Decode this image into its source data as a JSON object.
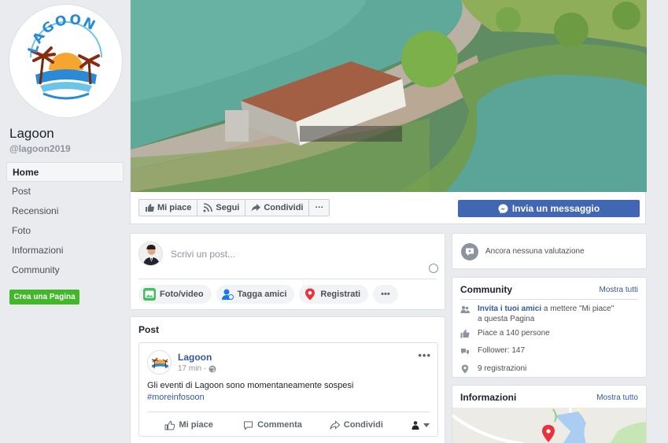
{
  "page": {
    "name": "Lagoon",
    "handle": "@lagoon2019",
    "logo_text": "LAGOON"
  },
  "nav": {
    "items": [
      {
        "label": "Home",
        "active": true
      },
      {
        "label": "Post"
      },
      {
        "label": "Recensioni"
      },
      {
        "label": "Foto"
      },
      {
        "label": "Informazioni"
      },
      {
        "label": "Community"
      }
    ],
    "create_page": "Crea una Pagina"
  },
  "cover_actions": {
    "like": "Mi piace",
    "follow": "Segui",
    "share": "Condividi",
    "more": "···",
    "message": "Invia un messaggio"
  },
  "composer": {
    "placeholder": "Scrivi un post...",
    "photo": "Foto/video",
    "tag": "Tagga amici",
    "checkin": "Registrati",
    "more": "•••"
  },
  "posts": {
    "title": "Post",
    "item": {
      "author": "Lagoon",
      "time": "17 min ·",
      "text": "Gli eventi di Lagoon sono momentaneamente sospesi",
      "hashtag": "#moreinfosoon",
      "like": "Mi piace",
      "comment": "Commenta",
      "share": "Condividi"
    }
  },
  "rating": {
    "text": "Ancora nessuna valutazione"
  },
  "community": {
    "title": "Community",
    "link": "Mostra tutti",
    "invite_link": "Invita i tuoi amici",
    "invite_rest": " a mettere \"Mi piace\" a questa Pagina",
    "likes": "Piace a 140 persone",
    "followers": "Follower: 147",
    "checkins": "9 registrazioni"
  },
  "info": {
    "title": "Informazioni",
    "link": "Mostra tutto"
  },
  "colors": {
    "brand_blue": "#4267b2",
    "link_blue": "#365899",
    "green": "#42b72a",
    "background": "#e9ebee"
  }
}
